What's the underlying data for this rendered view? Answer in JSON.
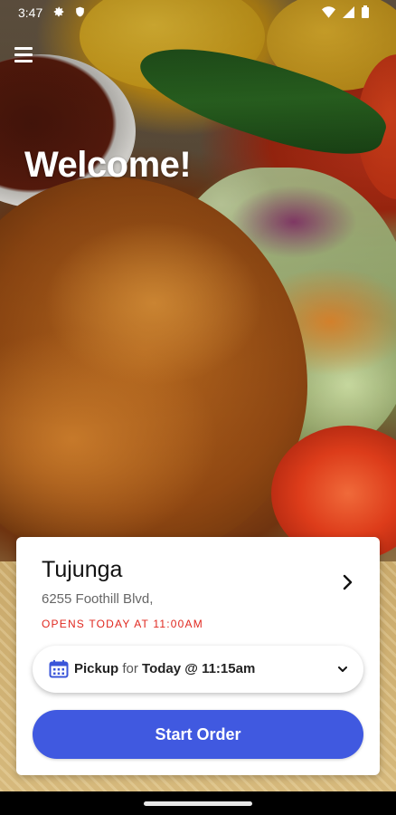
{
  "status_bar": {
    "time": "3:47",
    "left_icons": [
      "gear-icon",
      "shield-icon"
    ],
    "right_icons": [
      "wifi-icon",
      "signal-icon",
      "battery-icon"
    ]
  },
  "header": {
    "menu_icon": "hamburger-menu-icon",
    "welcome": "Welcome!"
  },
  "store_card": {
    "name": "Tujunga",
    "address": "6255 Foothill Blvd,",
    "hours": "OPENS TODAY AT 11:00AM",
    "hours_color": "#e0281f",
    "chevron_icon": "chevron-right-icon"
  },
  "pickup": {
    "icon": "calendar-icon",
    "mode": "Pickup",
    "connector": "for",
    "when": "Today @ 11:15am",
    "dropdown_icon": "chevron-down-icon"
  },
  "start_button": {
    "label": "Start Order",
    "color": "#4059e0"
  }
}
